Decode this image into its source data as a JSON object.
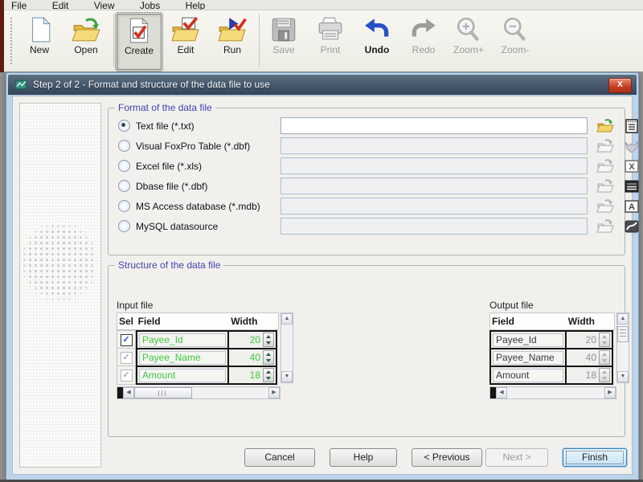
{
  "colors": {
    "field_name_green": "#3ecb3e",
    "group_label_purple": "#4343ae",
    "titlebar_slate": "#33445a",
    "close_red": "#c23c22",
    "folder_yellow": "#f7da7a",
    "check_red": "#d0321c",
    "undo_blue": "#2b50c8"
  },
  "menu": {
    "items": [
      {
        "label": "File"
      },
      {
        "label": "Edit"
      },
      {
        "label": "View"
      },
      {
        "label": "Jobs"
      },
      {
        "label": "Help"
      }
    ]
  },
  "toolbar": {
    "buttons": [
      {
        "label": "New"
      },
      {
        "label": "Open"
      },
      {
        "label": "Create"
      },
      {
        "label": "Edit"
      },
      {
        "label": "Run"
      },
      {
        "label": "Save"
      },
      {
        "label": "Print"
      },
      {
        "label": "Undo"
      },
      {
        "label": "Redo"
      },
      {
        "label": "Zoom+"
      },
      {
        "label": "Zoom-"
      }
    ]
  },
  "dialog": {
    "title": "Step 2 of 2 - Format and structure of the data file to use",
    "close_label": "X",
    "format": {
      "label": "Format of the data file",
      "options": [
        {
          "label": "Text file (*.txt)",
          "selected": true,
          "value": "",
          "enabled": true
        },
        {
          "label": "Visual FoxPro Table (*.dbf)",
          "selected": false,
          "value": "",
          "enabled": false
        },
        {
          "label": "Excel file (*.xls)",
          "selected": false,
          "value": "",
          "enabled": false
        },
        {
          "label": "Dbase file (*.dbf)",
          "selected": false,
          "value": "",
          "enabled": false
        },
        {
          "label": "MS Access database (*.mdb)",
          "selected": false,
          "value": "",
          "enabled": false
        },
        {
          "label": "MySQL datasource",
          "selected": false,
          "value": "",
          "enabled": false
        }
      ]
    },
    "structure": {
      "label": "Structure of the data file",
      "input_table": {
        "label": "Input file",
        "headers": [
          "Sel",
          "Field",
          "Width"
        ],
        "rows": [
          {
            "selected": true,
            "field": "Payee_Id",
            "width": "20"
          },
          {
            "selected": true,
            "field": "Payee_Name",
            "width": "40"
          },
          {
            "selected": true,
            "field": "Amount",
            "width": "18"
          }
        ]
      },
      "output_table": {
        "label": "Output file",
        "headers": [
          "Field",
          "Width"
        ],
        "rows": [
          {
            "field": "Payee_Id",
            "width": "20"
          },
          {
            "field": "Payee_Name",
            "width": "40"
          },
          {
            "field": "Amount",
            "width": "18"
          }
        ]
      }
    },
    "buttons": {
      "cancel": "Cancel",
      "help": "Help",
      "previous": "< Previous",
      "next": "Next >",
      "finish": "Finish"
    }
  }
}
